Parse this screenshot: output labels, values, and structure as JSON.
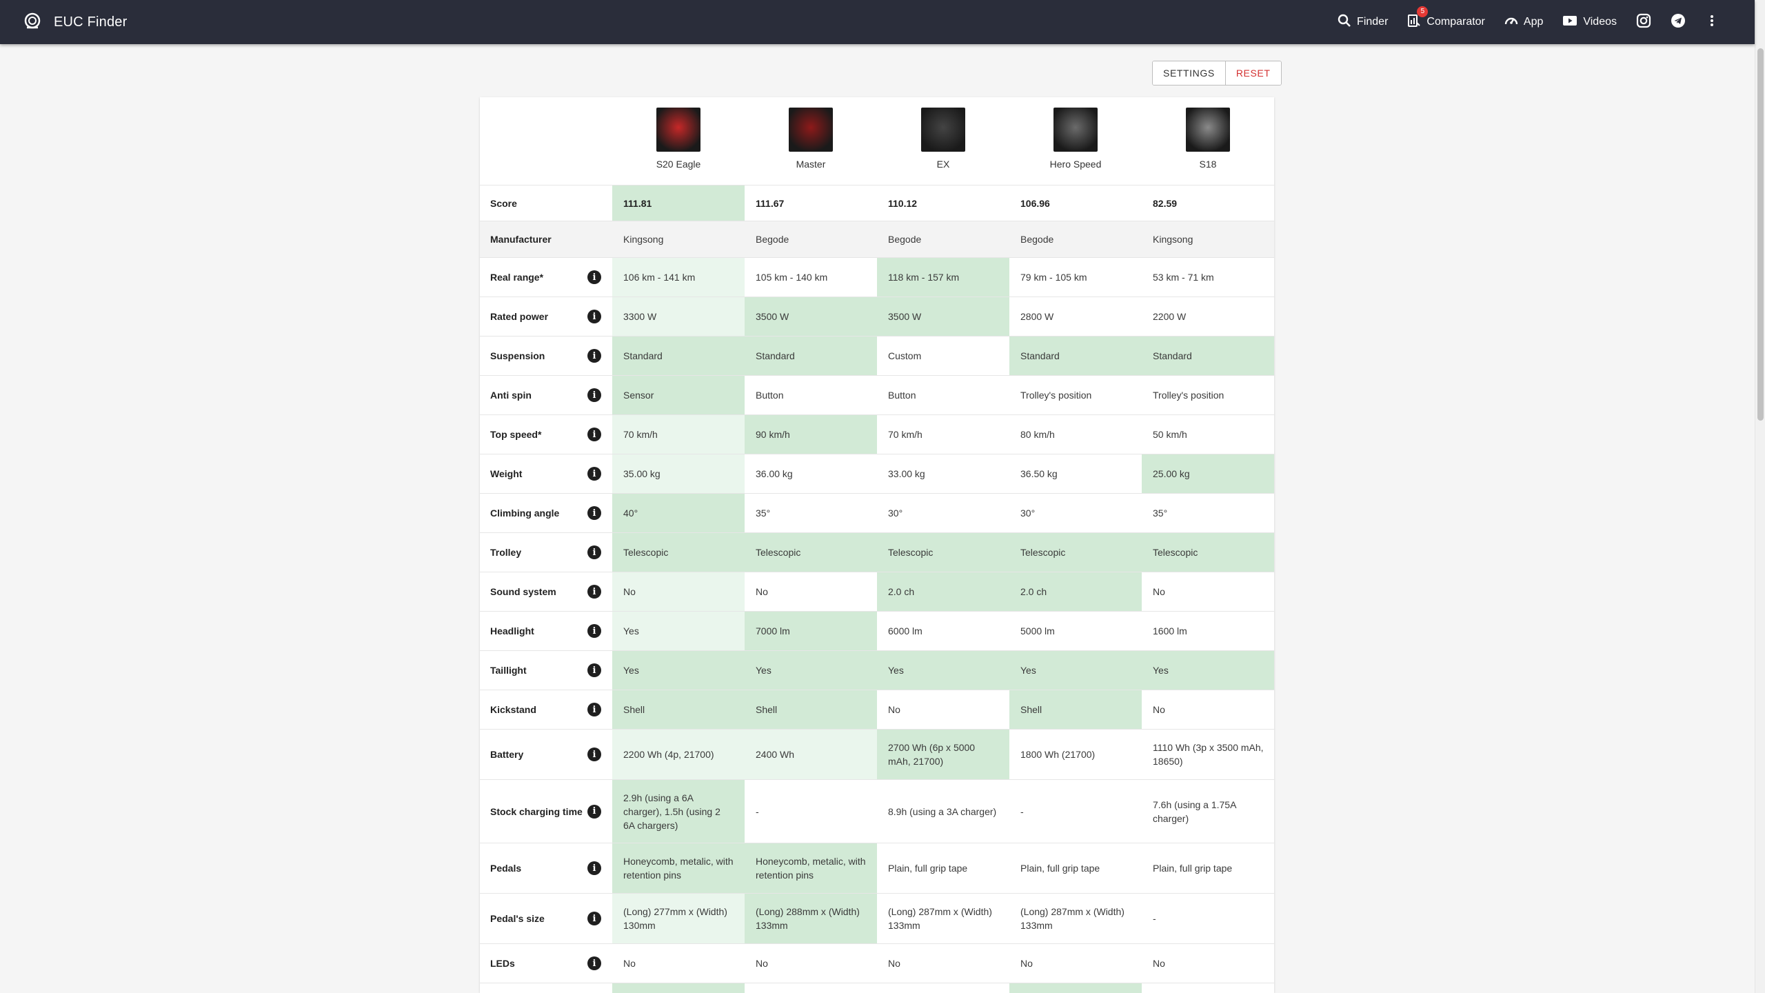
{
  "app": {
    "title": "EUC Finder"
  },
  "nav": {
    "finder": "Finder",
    "comparator": "Comparator",
    "comparator_badge": "5",
    "app": "App",
    "videos": "Videos"
  },
  "actions": {
    "settings": "SETTINGS",
    "reset": "RESET"
  },
  "wheels": [
    {
      "name": "S20 Eagle",
      "thumb_color": "#c62828"
    },
    {
      "name": "Master",
      "thumb_color": "#8e1a1a"
    },
    {
      "name": "EX",
      "thumb_color": "#444444"
    },
    {
      "name": "Hero Speed",
      "thumb_color": "#6b6b6b"
    },
    {
      "name": "S18",
      "thumb_color": "#8a8a8a"
    }
  ],
  "rows": [
    {
      "label": "Score",
      "info": false,
      "score": true,
      "height": 52,
      "values": [
        "111.81",
        "111.67",
        "110.12",
        "106.96",
        "82.59"
      ],
      "hl": [
        "best",
        "",
        "",
        "",
        ""
      ]
    },
    {
      "label": "Manufacturer",
      "info": false,
      "height": 53,
      "shade": true,
      "values": [
        "Kingsong",
        "Begode",
        "Begode",
        "Begode",
        "Kingsong"
      ],
      "hl": [
        "",
        "",
        "",
        "",
        ""
      ]
    },
    {
      "label": "Real range*",
      "info": true,
      "height": 57,
      "values": [
        "106 km - 141 km",
        "105 km - 140 km",
        "118 km - 157 km",
        "79 km - 105 km",
        "53 km - 71 km"
      ],
      "hl": [
        "good",
        "",
        "best",
        "",
        ""
      ]
    },
    {
      "label": "Rated power",
      "info": true,
      "height": 57,
      "values": [
        "3300 W",
        "3500 W",
        "3500 W",
        "2800 W",
        "2200 W"
      ],
      "hl": [
        "good",
        "best",
        "best",
        "",
        ""
      ]
    },
    {
      "label": "Suspension",
      "info": true,
      "height": 57,
      "values": [
        "Standard",
        "Standard",
        "Custom",
        "Standard",
        "Standard"
      ],
      "hl": [
        "best",
        "best",
        "",
        "best",
        "best"
      ]
    },
    {
      "label": "Anti spin",
      "info": true,
      "height": 57,
      "values": [
        "Sensor",
        "Button",
        "Button",
        "Trolley's position",
        "Trolley's position"
      ],
      "hl": [
        "best",
        "",
        "",
        "",
        ""
      ]
    },
    {
      "label": "Top speed*",
      "info": true,
      "height": 57,
      "values": [
        "70 km/h",
        "90 km/h",
        "70 km/h",
        "80 km/h",
        "50 km/h"
      ],
      "hl": [
        "good",
        "best",
        "",
        "",
        ""
      ]
    },
    {
      "label": "Weight",
      "info": true,
      "height": 57,
      "values": [
        "35.00 kg",
        "36.00 kg",
        "33.00 kg",
        "36.50 kg",
        "25.00 kg"
      ],
      "hl": [
        "good",
        "",
        "",
        "",
        "best"
      ]
    },
    {
      "label": "Climbing angle",
      "info": true,
      "height": 57,
      "values": [
        "40°",
        "35°",
        "30°",
        "30°",
        "35°"
      ],
      "hl": [
        "best",
        "",
        "",
        "",
        ""
      ]
    },
    {
      "label": "Trolley",
      "info": true,
      "height": 57,
      "values": [
        "Telescopic",
        "Telescopic",
        "Telescopic",
        "Telescopic",
        "Telescopic"
      ],
      "hl": [
        "best",
        "best",
        "best",
        "best",
        "best"
      ]
    },
    {
      "label": "Sound system",
      "info": true,
      "height": 57,
      "values": [
        "No",
        "No",
        "2.0 ch",
        "2.0 ch",
        "No"
      ],
      "hl": [
        "good",
        "",
        "best",
        "best",
        ""
      ]
    },
    {
      "label": "Headlight",
      "info": true,
      "height": 57,
      "values": [
        "Yes",
        "7000 lm",
        "6000 lm",
        "5000 lm",
        "1600 lm"
      ],
      "hl": [
        "good",
        "best",
        "",
        "",
        ""
      ]
    },
    {
      "label": "Taillight",
      "info": true,
      "height": 57,
      "values": [
        "Yes",
        "Yes",
        "Yes",
        "Yes",
        "Yes"
      ],
      "hl": [
        "best",
        "best",
        "best",
        "best",
        "best"
      ]
    },
    {
      "label": "Kickstand",
      "info": true,
      "height": 57,
      "values": [
        "Shell",
        "Shell",
        "No",
        "Shell",
        "No"
      ],
      "hl": [
        "best",
        "best",
        "",
        "best",
        ""
      ]
    },
    {
      "label": "Battery",
      "info": true,
      "height": 73,
      "values": [
        "2200 Wh (4p, 21700)",
        "2400 Wh",
        "2700 Wh (6p x 5000 mAh, 21700)",
        "1800 Wh (21700)",
        "1110 Wh (3p x 3500 mAh, 18650)"
      ],
      "hl": [
        "good",
        "good",
        "best",
        "",
        ""
      ]
    },
    {
      "label": "Stock charging time",
      "info": true,
      "height": 92,
      "values": [
        "2.9h (using a 6A charger), 1.5h (using 2 6A chargers)",
        "-",
        "8.9h (using a 3A charger)",
        "-",
        "7.6h (using a 1.75A charger)"
      ],
      "hl": [
        "best",
        "",
        "",
        "",
        ""
      ]
    },
    {
      "label": "Pedals",
      "info": true,
      "height": 73,
      "values": [
        "Honeycomb, metalic, with retention pins",
        "Honeycomb, metalic, with retention pins",
        "Plain, full grip tape",
        "Plain, full grip tape",
        "Plain, full grip tape"
      ],
      "hl": [
        "best",
        "best",
        "",
        "",
        ""
      ]
    },
    {
      "label": "Pedal's size",
      "info": true,
      "height": 73,
      "values": [
        "(Long) 277mm x (Width) 130mm",
        "(Long) 288mm x (Width) 133mm",
        "(Long) 287mm x (Width) 133mm",
        "(Long) 287mm x (Width) 133mm",
        "-"
      ],
      "hl": [
        "good",
        "best",
        "",
        "",
        ""
      ]
    },
    {
      "label": "LEDs",
      "info": true,
      "height": 57,
      "values": [
        "No",
        "No",
        "No",
        "No",
        "No"
      ],
      "hl": [
        "",
        "",
        "",
        "",
        ""
      ]
    },
    {
      "label": "",
      "info": false,
      "height": 57,
      "values": [
        "",
        "",
        "",
        "",
        ""
      ],
      "hl": [
        "best",
        "",
        "",
        "best",
        ""
      ]
    }
  ]
}
